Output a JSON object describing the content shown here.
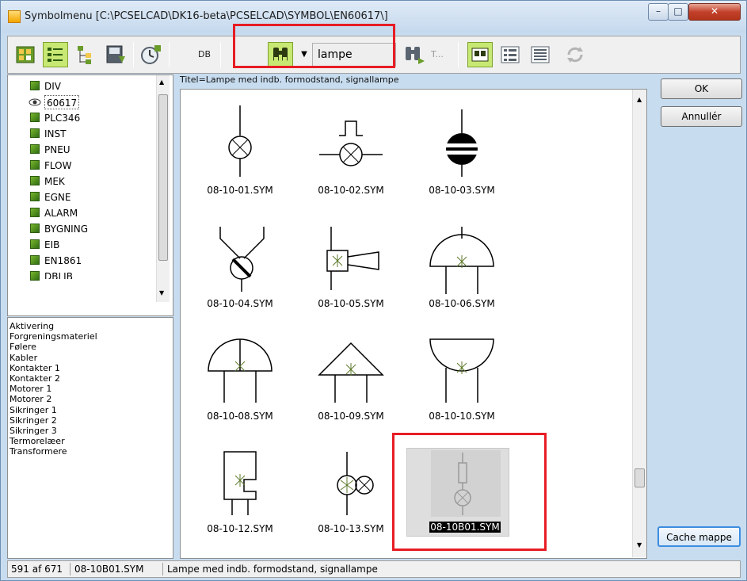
{
  "window": {
    "title": "Symbolmenu [C:\\PCSELCAD\\DK16-beta\\PCSELCAD\\SYMBOL\\EN60617\\]"
  },
  "toolbar": {
    "db_label": "DB",
    "search_value": "lampe",
    "text_tool_label": "T..."
  },
  "folders": [
    {
      "label": "DIV"
    },
    {
      "label": "60617"
    },
    {
      "label": "PLC346"
    },
    {
      "label": "INST"
    },
    {
      "label": "PNEU"
    },
    {
      "label": "FLOW"
    },
    {
      "label": "MEK"
    },
    {
      "label": "EGNE"
    },
    {
      "label": "ALARM"
    },
    {
      "label": "BYGNING"
    },
    {
      "label": "EIB"
    },
    {
      "label": "EN1861"
    },
    {
      "label": "DBLIB"
    }
  ],
  "categories": [
    "Aktivering",
    "Forgreningsmateriel",
    "Følere",
    "Kabler",
    "Kontakter 1",
    "Kontakter 2",
    "Motorer 1",
    "Motorer 2",
    "Sikringer 1",
    "Sikringer 2",
    "Sikringer 3",
    "Termorelæer",
    "Transformere"
  ],
  "info_title": "Titel=Lampe med indb. formodstand, signallampe",
  "symbols": [
    {
      "label": "08-10-01.SYM"
    },
    {
      "label": "08-10-02.SYM"
    },
    {
      "label": "08-10-03.SYM"
    },
    {
      "label": "08-10-04.SYM"
    },
    {
      "label": "08-10-05.SYM"
    },
    {
      "label": "08-10-06.SYM"
    },
    {
      "label": "08-10-08.SYM"
    },
    {
      "label": "08-10-09.SYM"
    },
    {
      "label": "08-10-10.SYM"
    },
    {
      "label": "08-10-12.SYM"
    },
    {
      "label": "08-10-13.SYM"
    },
    {
      "label": "08-10B01.SYM"
    }
  ],
  "buttons": {
    "ok": "OK",
    "cancel": "Annullér",
    "cache": "Cache mappe"
  },
  "status": {
    "count": "591 af 671",
    "file": "08-10B01.SYM",
    "description": "Lampe med indb. formodstand, signallampe"
  },
  "colors": {
    "highlight": "#e81c24",
    "active_tool": "#c8e874",
    "folder_green": "#4a8a1c"
  }
}
